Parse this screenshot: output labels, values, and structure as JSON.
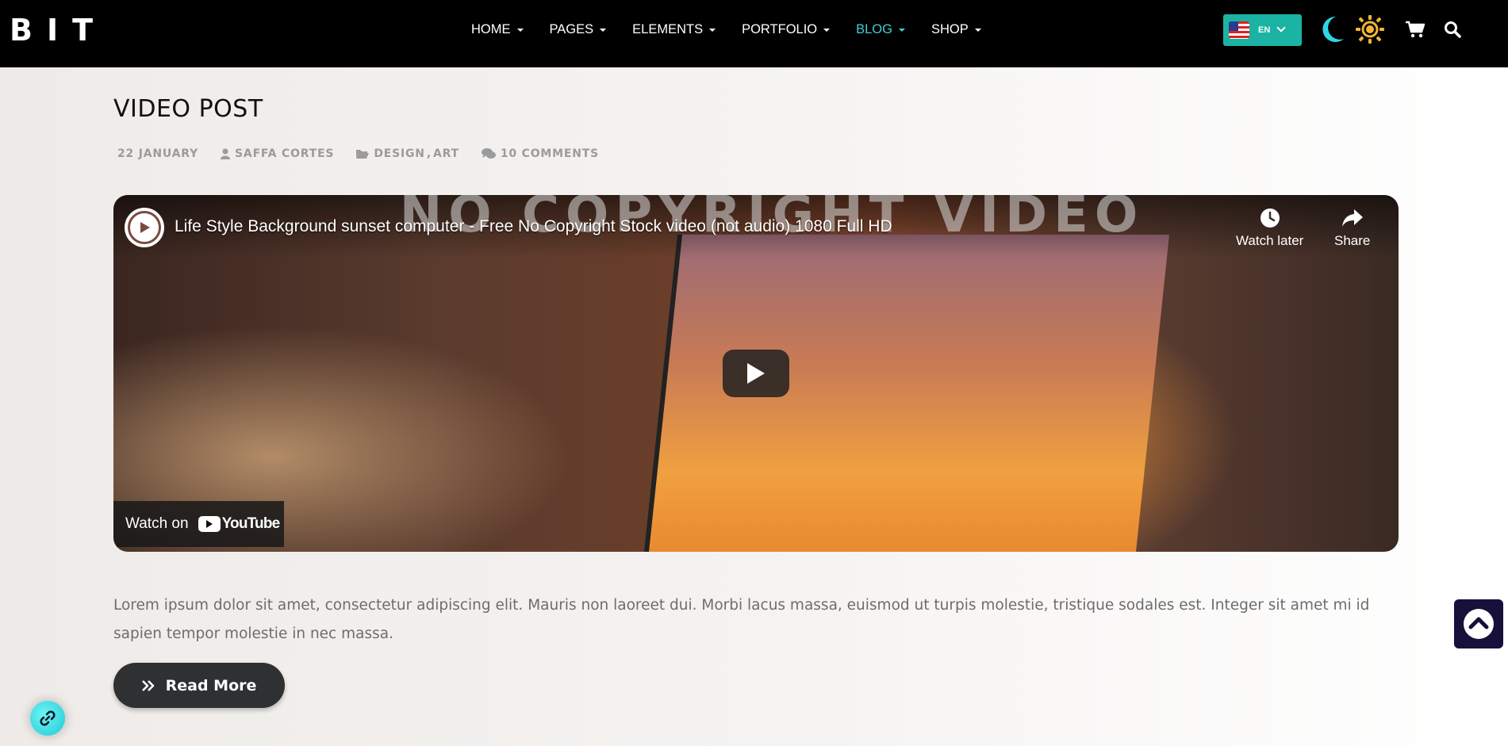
{
  "brand": {
    "logo_text": "BIT"
  },
  "nav": {
    "items": [
      {
        "label": "HOME",
        "active": false
      },
      {
        "label": "PAGES",
        "active": false
      },
      {
        "label": "ELEMENTS",
        "active": false
      },
      {
        "label": "PORTFOLIO",
        "active": false
      },
      {
        "label": "BLOG",
        "active": true
      },
      {
        "label": "SHOP",
        "active": false
      }
    ],
    "language": {
      "label": "EN",
      "flag": "us-flag-icon"
    },
    "icons": [
      "moon-icon",
      "sun-icon",
      "cart-icon",
      "search-icon"
    ],
    "accent_color": "#3fd0d8"
  },
  "post": {
    "title": "VIDEO POST",
    "meta": {
      "date": "22 JANUARY",
      "author": "SAFFA CORTES",
      "categories": [
        "DESIGN",
        "ART"
      ],
      "comments": "10 COMMENTS"
    },
    "video": {
      "watermark": "NO COPYRIGHT VIDEO",
      "title": "Life Style Background sunset computer - Free No Copyright Stock video (not audio) 1080 Full HD",
      "watch_later_label": "Watch later",
      "share_label": "Share",
      "watch_on_label": "Watch on",
      "youtube_label": "YouTube"
    },
    "excerpt": "Lorem ipsum dolor sit amet, consectetur adipiscing elit. Mauris non laoreet dui. Morbi lacus massa, euismod ut turpis molestie, tristique sodales est. Integer sit amet mi id sapien tempor molestie in nec massa.",
    "read_more_label": "Read More"
  }
}
